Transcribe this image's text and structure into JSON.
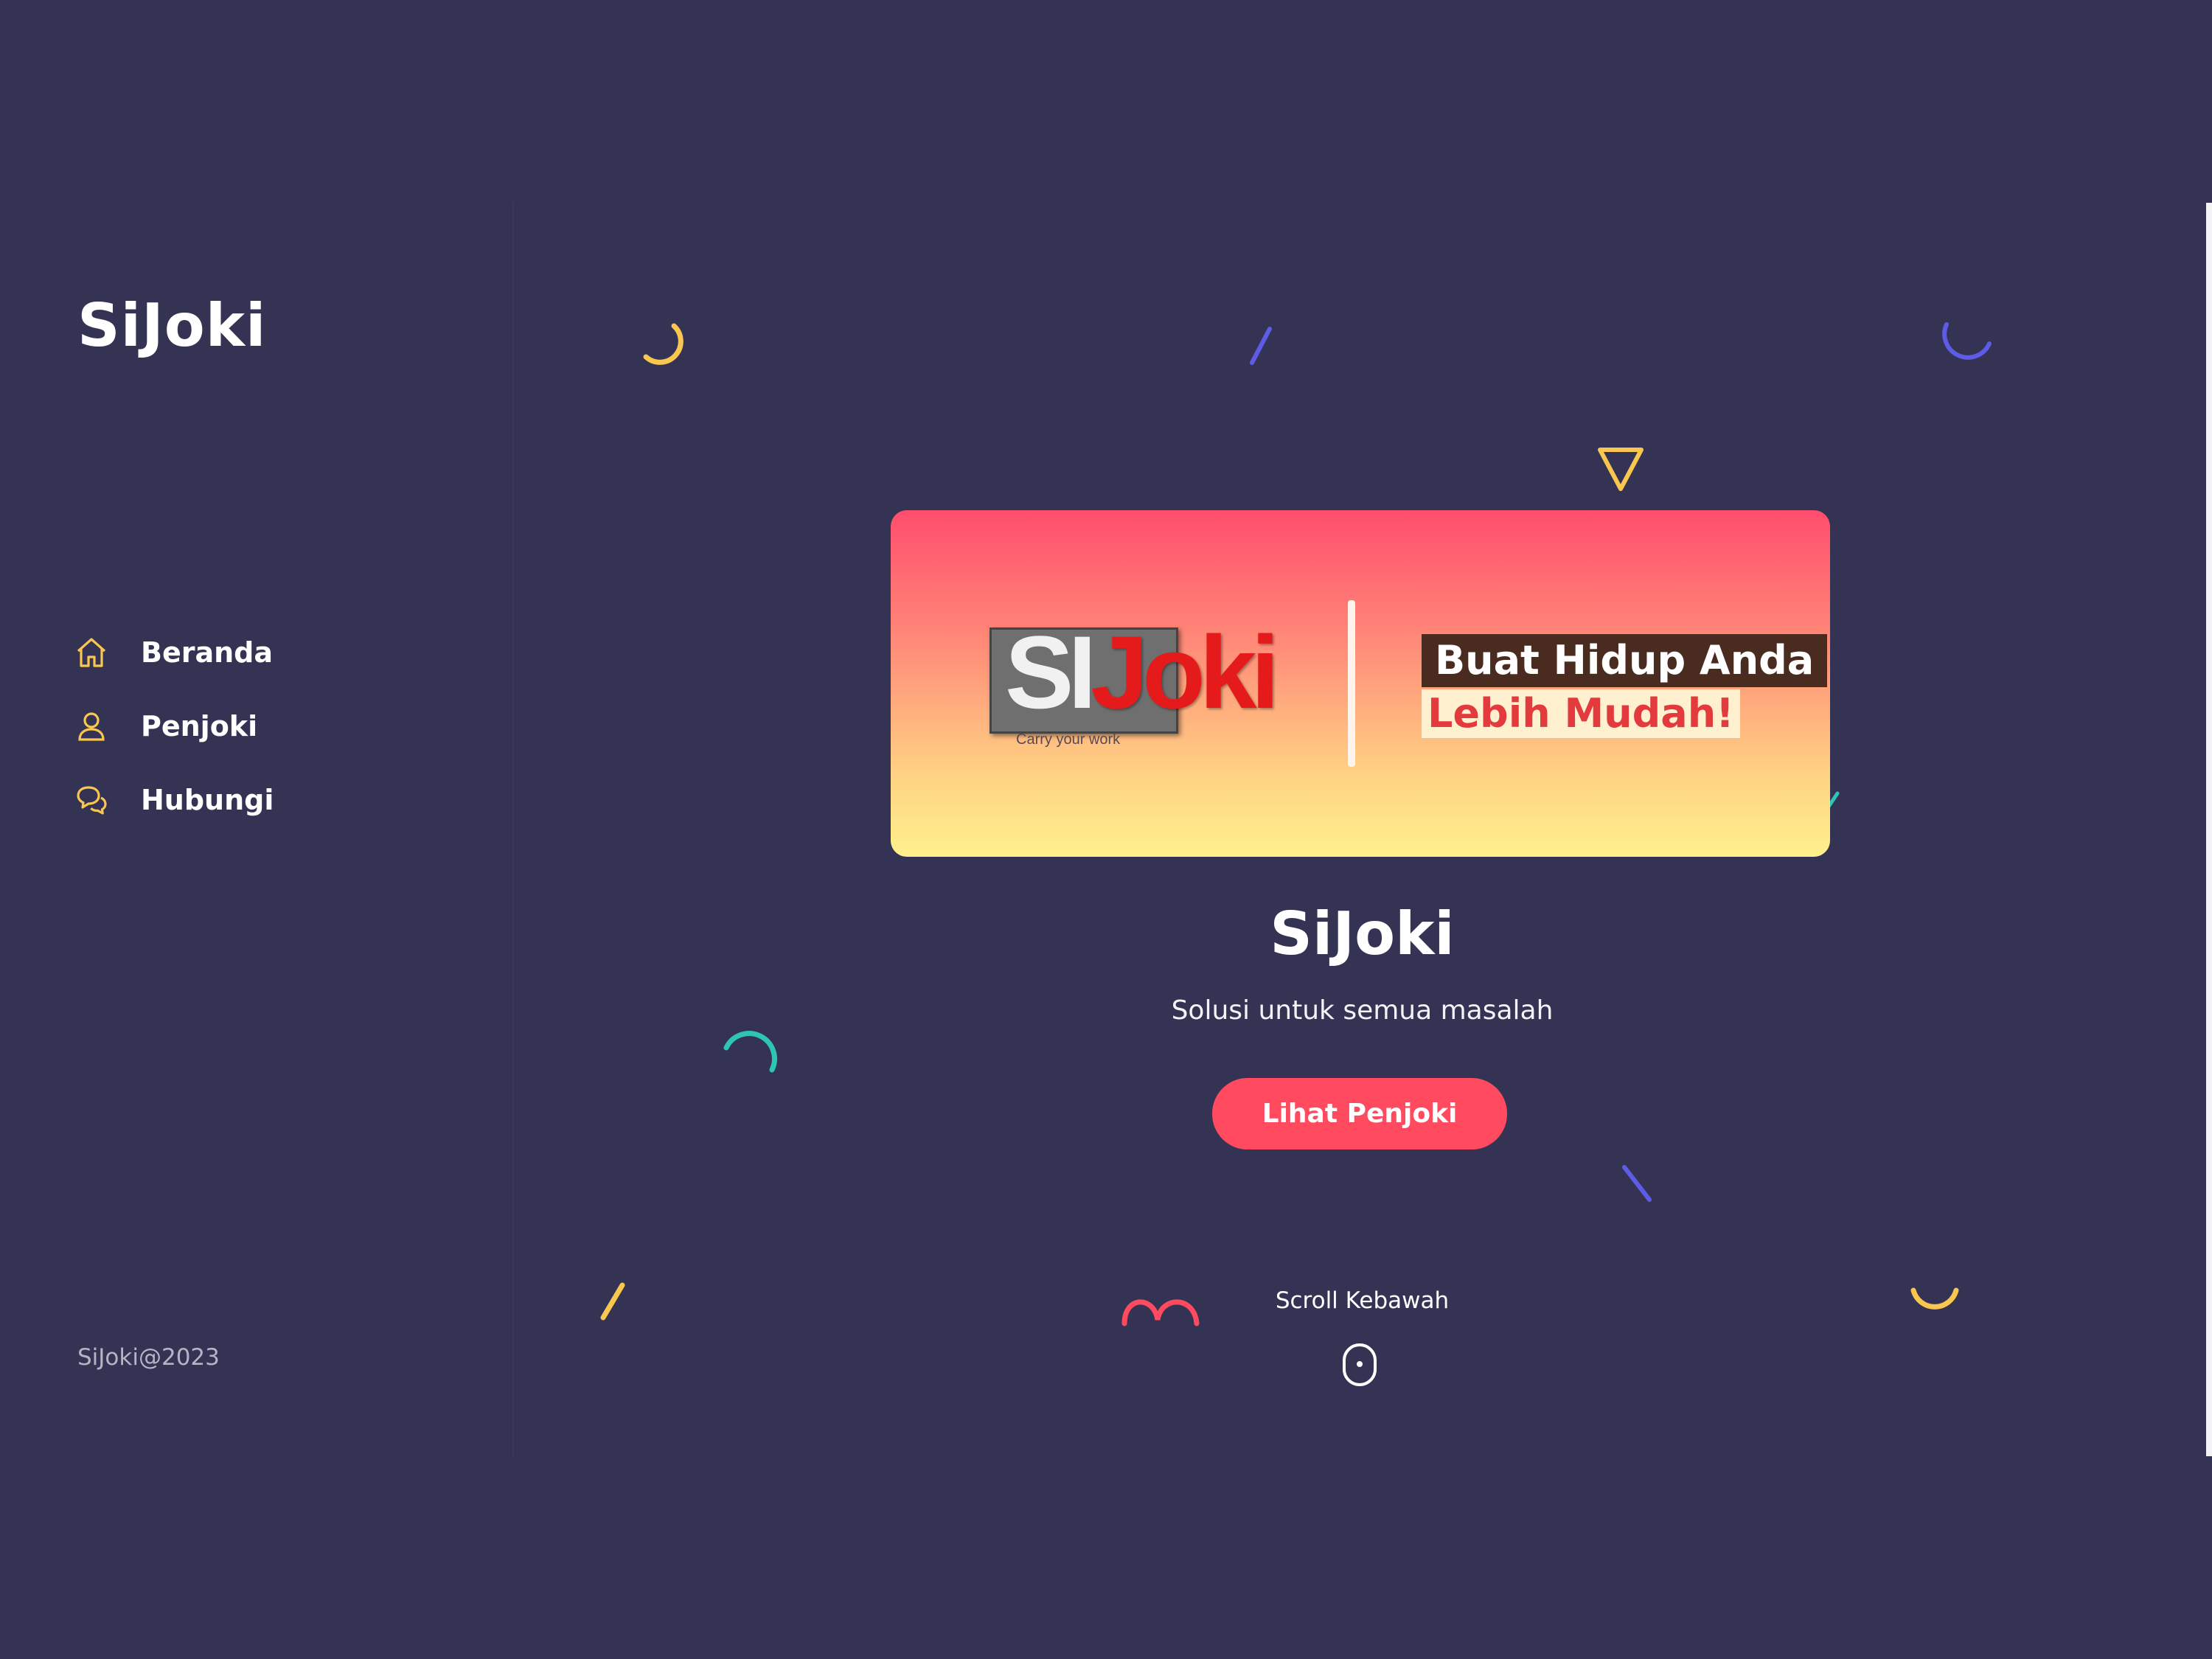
{
  "sidebar": {
    "brand": "SiJoki",
    "nav": [
      {
        "label": "Beranda",
        "icon": "home-icon"
      },
      {
        "label": "Penjoki",
        "icon": "user-icon"
      },
      {
        "label": "Hubungi",
        "icon": "chat-icon"
      }
    ],
    "footer": "SiJoki@2023"
  },
  "banner": {
    "logo_si": "SI",
    "logo_joki": "Joki",
    "logo_tagline": "Carry your work",
    "tagline_line1": "Buat Hidup Anda",
    "tagline_line2": "Lebih Mudah!"
  },
  "hero": {
    "title": "SiJoki",
    "subtitle": "Solusi untuk semua masalah",
    "cta_label": "Lihat Penjoki",
    "scroll_label": "Scroll Kebawah"
  },
  "colors": {
    "background": "#353353",
    "accent": "#ff4a5f",
    "nav_icon": "#f9c74f",
    "deco_yellow": "#f9c74f",
    "deco_blue": "#5e5ce6",
    "deco_teal": "#2ec4b6",
    "deco_pink": "#ff4a5f"
  }
}
